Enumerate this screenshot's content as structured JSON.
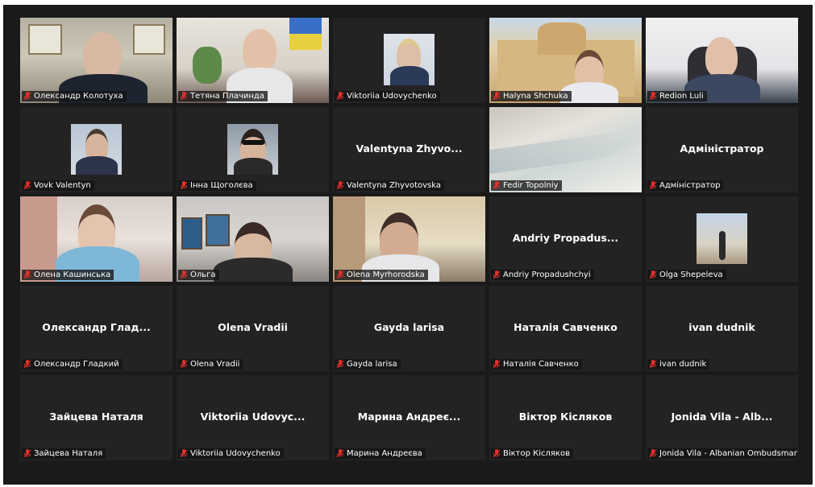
{
  "participants": [
    {
      "id": "p1",
      "center": "",
      "label": "Олександр Колотуха",
      "video": "certs"
    },
    {
      "id": "p2",
      "center": "",
      "label": "Тетяна Плачинда",
      "video": "room"
    },
    {
      "id": "p3",
      "center": "",
      "label": "Viktoriia Udovychenko",
      "video": "thumb"
    },
    {
      "id": "p4",
      "center": "",
      "label": "Halyna Shchuka",
      "video": "building"
    },
    {
      "id": "p5",
      "center": "",
      "label": "Redion Luli",
      "video": "office"
    },
    {
      "id": "p6",
      "center": "",
      "label": "Vovk Valentyn",
      "video": "thumb"
    },
    {
      "id": "p7",
      "center": "",
      "label": "Інна Щоголєва",
      "video": "thumb"
    },
    {
      "id": "p8",
      "center": "Valentyna  Zhyvo...",
      "label": "Valentyna Zhyvotovska",
      "video": "none"
    },
    {
      "id": "p9",
      "center": "",
      "label": "Fedir Topolniy",
      "video": "sky"
    },
    {
      "id": "p10",
      "center": "Адміністратор",
      "label": "Адміністратор",
      "video": "none"
    },
    {
      "id": "p11",
      "center": "",
      "label": "Олена Кашинська",
      "video": "flowers"
    },
    {
      "id": "p12",
      "center": "",
      "label": "Ольга",
      "video": "wall",
      "active": true
    },
    {
      "id": "p13",
      "center": "",
      "label": "Olena  Myrhorodska",
      "video": "beige"
    },
    {
      "id": "p14",
      "center": "Andriy  Propadus...",
      "label": "Andriy Propadushchyi",
      "video": "none"
    },
    {
      "id": "p15",
      "center": "",
      "label": "Olga Shepeleva",
      "video": "thumb"
    },
    {
      "id": "p16",
      "center": "Олександр  Глад...",
      "label": "Олександр Гладкий",
      "video": "none"
    },
    {
      "id": "p17",
      "center": "Olena Vradii",
      "label": "Olena Vradii",
      "video": "none"
    },
    {
      "id": "p18",
      "center": "Gayda larisa",
      "label": "Gayda larisa",
      "video": "none"
    },
    {
      "id": "p19",
      "center": "Наталія Савченко",
      "label": "Наталія Савченко",
      "video": "none"
    },
    {
      "id": "p20",
      "center": "ivan dudnik",
      "label": "ivan dudnik",
      "video": "none"
    },
    {
      "id": "p21",
      "center": "Зайцева Наталя",
      "label": "Зайцева Наталя",
      "video": "none"
    },
    {
      "id": "p22",
      "center": "Viktoriia  Udovyc...",
      "label": "Viktoriia Udovychenko",
      "video": "none"
    },
    {
      "id": "p23",
      "center": "Марина  Андреє...",
      "label": "Марина Андреєва",
      "video": "none"
    },
    {
      "id": "p24",
      "center": "Віктор Кісляков",
      "label": "Віктор Кісляков",
      "video": "none"
    },
    {
      "id": "p25",
      "center": "Jonida Vila - Alb...",
      "label": "Jonida Vila - Albanian Ombudsman...",
      "video": "none"
    }
  ],
  "colors": {
    "background": "#1a1a1a",
    "tile": "#232323",
    "active_border": "#e6e66f",
    "muted_mic": "#e0302b"
  },
  "icons": {
    "mic": "muted-mic-icon"
  }
}
